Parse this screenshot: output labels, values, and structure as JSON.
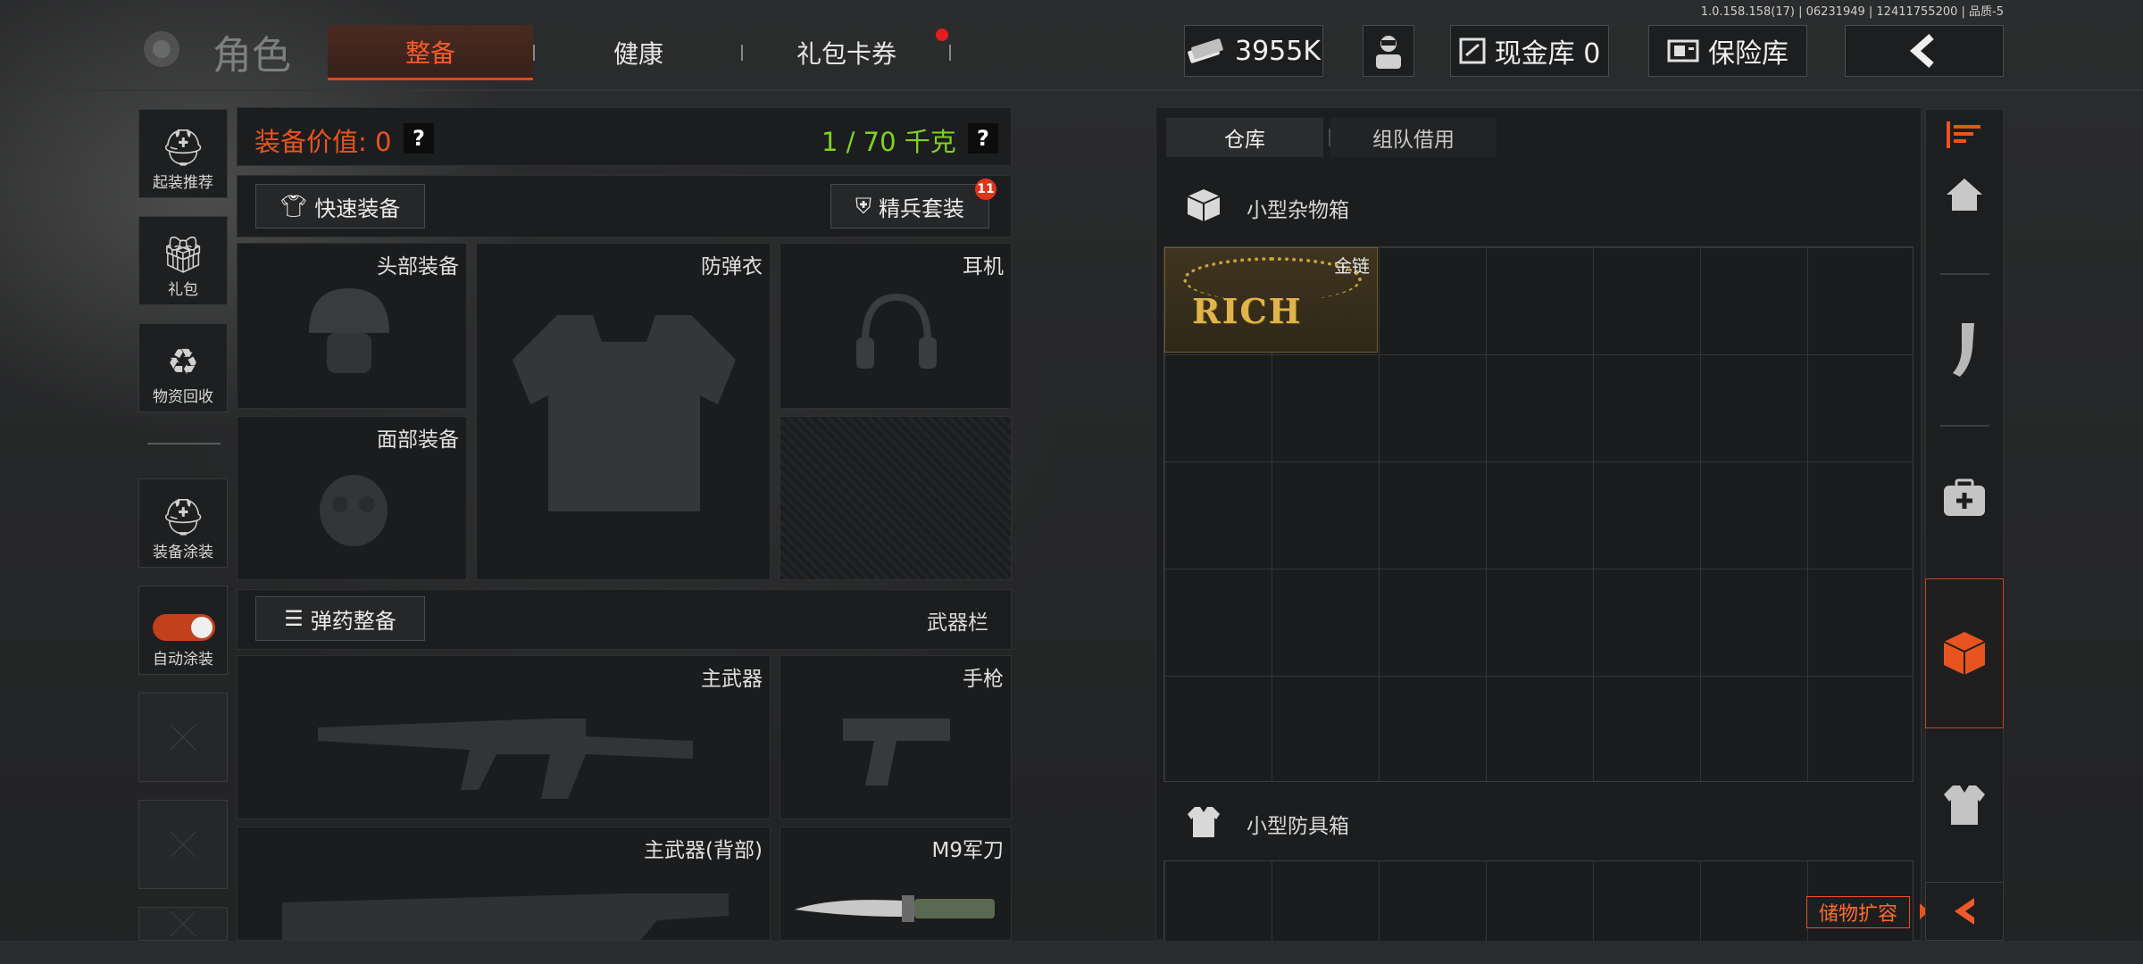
{
  "version": "1.0.158.158(17) | 06231949 | 12411755200 | 品质-5",
  "header": {
    "title": "角色",
    "tabs": [
      {
        "label": "整备",
        "active": true
      },
      {
        "label": "健康",
        "active": false
      },
      {
        "label": "礼包卡券",
        "active": false,
        "has_notification": true
      }
    ],
    "currency": "3955K",
    "cash_vault": "现金库 0",
    "safe_vault": "保险库",
    "colors": {
      "accent": "#e0471c",
      "notify": "#e61b1b"
    }
  },
  "sidebar": {
    "items": [
      {
        "label": "起装推荐",
        "icon": "loadout-recommend-icon"
      },
      {
        "label": "礼包",
        "icon": "gift-icon"
      },
      {
        "label": "物资回收",
        "icon": "recycle-icon"
      },
      {
        "label": "装备涂装",
        "icon": "paint-icon"
      },
      {
        "label": "自动涂装",
        "icon": "toggle-icon",
        "toggle_on": true
      }
    ]
  },
  "equipment": {
    "value_label": "装备价值: 0",
    "weight_label": "1 / 70 千克",
    "help": "?",
    "quick_equip": "快速装备",
    "elite_set": "精兵套装",
    "elite_badge": "11",
    "slots": {
      "head": "头部装备",
      "armor": "防弹衣",
      "headset": "耳机",
      "face": "面部装备"
    },
    "ammo_btn": "弹药整备",
    "weapon_bar": "武器栏",
    "weapon_slots": {
      "primary": "主武器",
      "pistol": "手枪",
      "primary_back": "主武器(背部)",
      "melee": "M9军刀"
    }
  },
  "storage": {
    "tabs": [
      {
        "label": "仓库",
        "active": true
      },
      {
        "label": "组队借用",
        "active": false
      }
    ],
    "section1": "小型杂物箱",
    "item1_name": "金链",
    "item1_art": "RICH",
    "section2": "小型防具箱",
    "expand_btn": "储物扩容"
  },
  "rail_icons": [
    "filter-icon",
    "home-icon",
    "magazine-icon",
    "medkit-icon",
    "crate-icon",
    "vest-icon",
    "collapse-icon"
  ]
}
